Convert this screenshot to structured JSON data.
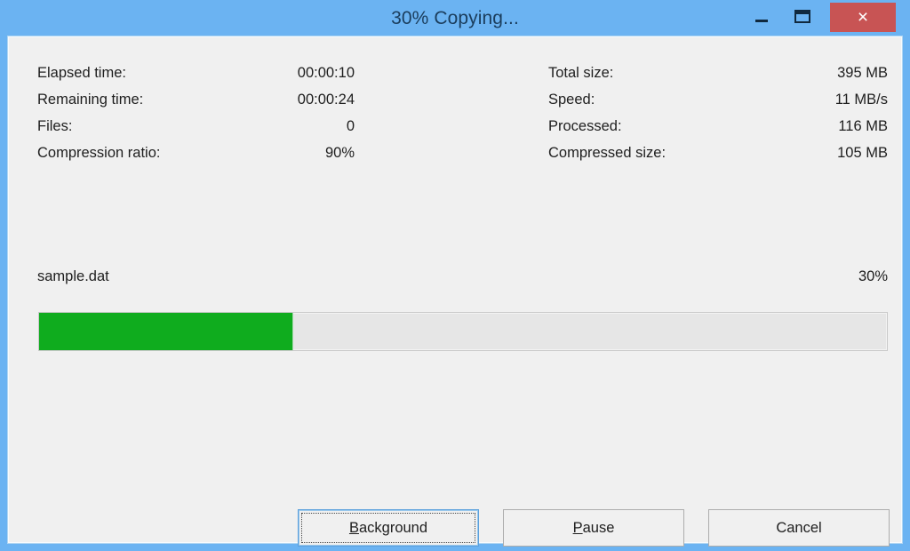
{
  "window": {
    "title": "30% Copying...",
    "frame_color": "#6BB3F2",
    "client_color": "#F0F0F0",
    "controls": {
      "minimize": {
        "name": "minimize-button",
        "glyph": "–"
      },
      "maximize": {
        "name": "maximize-button",
        "glyph": "□"
      },
      "close": {
        "name": "close-button",
        "glyph": "×",
        "color": "#C85454"
      }
    }
  },
  "stats": {
    "left": [
      {
        "label": "Elapsed time:",
        "value": "00:00:10"
      },
      {
        "label": "Remaining time:",
        "value": "00:00:24"
      },
      {
        "label": "Files:",
        "value": "0"
      },
      {
        "label": "Compression ratio:",
        "value": "90%"
      }
    ],
    "right": [
      {
        "label": "Total size:",
        "value": "395 MB"
      },
      {
        "label": "Speed:",
        "value": "11 MB/s"
      },
      {
        "label": "Processed:",
        "value": "116 MB"
      },
      {
        "label": "Compressed size:",
        "value": "105 MB"
      }
    ]
  },
  "current_file": {
    "name": "sample.dat",
    "percent_label": "30%"
  },
  "progress": {
    "percent": 30,
    "fill_color": "#0FAC1E",
    "track_color": "#E6E6E6"
  },
  "buttons": {
    "background": {
      "accel": "B",
      "rest": "ackground",
      "focused": true
    },
    "pause": {
      "accel": "P",
      "rest": "ause",
      "focused": false
    },
    "cancel": {
      "accel": "",
      "rest": "Cancel",
      "focused": false
    }
  }
}
